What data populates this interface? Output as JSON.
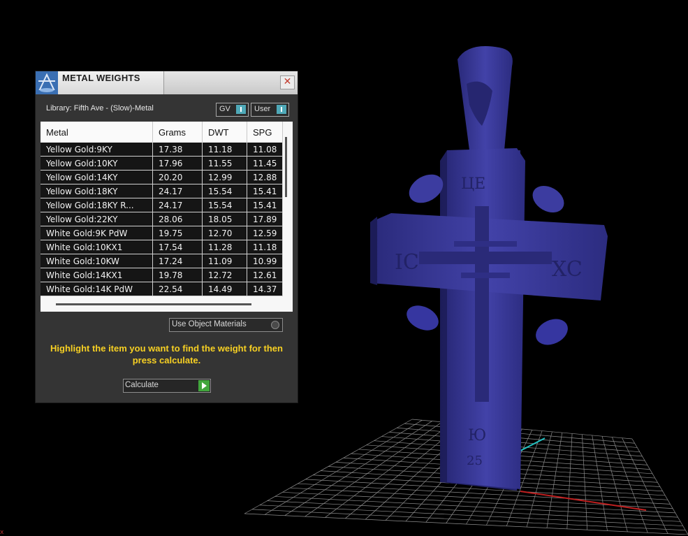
{
  "panel": {
    "title": "METAL WEIGHTS",
    "close_icon": "close-icon",
    "library_label": "Library: Fifth Ave - (Slow)-Metal",
    "toggles": [
      {
        "label": "GV",
        "on": true
      },
      {
        "label": "User",
        "on": true
      }
    ],
    "table": {
      "headers": [
        "Metal",
        "Grams",
        "DWT",
        "SPG"
      ],
      "rows": [
        [
          "Yellow Gold:9KY",
          "17.38",
          "11.18",
          "11.08"
        ],
        [
          "Yellow Gold:10KY",
          "17.96",
          "11.55",
          "11.45"
        ],
        [
          "Yellow Gold:14KY",
          "20.20",
          "12.99",
          "12.88"
        ],
        [
          "Yellow Gold:18KY",
          "24.17",
          "15.54",
          "15.41"
        ],
        [
          "Yellow Gold:18KY R...",
          "24.17",
          "15.54",
          "15.41"
        ],
        [
          "Yellow Gold:22KY",
          "28.06",
          "18.05",
          "17.89"
        ],
        [
          "White Gold:9K PdW",
          "19.75",
          "12.70",
          "12.59"
        ],
        [
          "White Gold:10KX1",
          "17.54",
          "11.28",
          "11.18"
        ],
        [
          "White Gold:10KW",
          "17.24",
          "11.09",
          "10.99"
        ],
        [
          "White Gold:14KX1",
          "19.78",
          "12.72",
          "12.61"
        ],
        [
          "White Gold:14K PdW",
          "22.54",
          "14.49",
          "14.37"
        ]
      ]
    },
    "use_object_materials": "Use Object Materials",
    "hint_text": "Highlight the item you want to find the weight for then press calculate.",
    "calculate_label": "Calculate",
    "accent_color": "#f7d023",
    "toggle_color": "#4fa9b8",
    "play_color": "#41a63c"
  },
  "viewport": {
    "model": "cross pendant",
    "model_color": "#3c3c9a",
    "grid_color": "#9a9a9a",
    "x_axis_color": "#c02020",
    "y_axis_color": "#20c0c0"
  },
  "corner_glyph": "x"
}
